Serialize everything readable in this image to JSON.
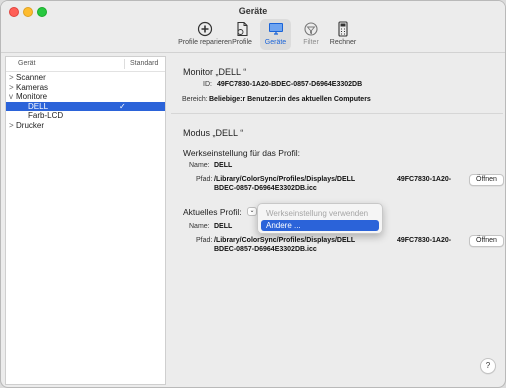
{
  "window": {
    "title": "Geräte"
  },
  "toolbar": {
    "items": [
      {
        "label": "Profile reparieren",
        "icon": "first-aid-icon"
      },
      {
        "label": "Profile",
        "icon": "profile-document-icon"
      },
      {
        "label": "Geräte",
        "icon": "display-icon",
        "active": true
      },
      {
        "label": "Filter",
        "icon": "filter-icon",
        "disabled": true
      },
      {
        "label": "Rechner",
        "icon": "calculator-icon"
      }
    ]
  },
  "sidebar": {
    "col_device": "Gerät",
    "col_standard": "Standard",
    "items": [
      {
        "label": "Scanner",
        "chevron": ">"
      },
      {
        "label": "Kameras",
        "chevron": ">"
      },
      {
        "label": "Monitore",
        "chevron": "v"
      },
      {
        "label": "DELL",
        "check": "✓"
      },
      {
        "label": "Farb-LCD"
      },
      {
        "label": "Drucker",
        "chevron": ">"
      }
    ]
  },
  "monitor": {
    "title": "Monitor „DELL          “",
    "id_label": "ID:",
    "id_value": "49FC7830-1A20-BDEC-0857-D6964E3302DB",
    "scope_label": "Bereich:",
    "scope_value": "Beliebige:r Benutzer:in des aktuellen Computers"
  },
  "mode": {
    "title": "Modus „DELL          “",
    "factory_heading": "Werkseinstellung für das Profil:",
    "name_label": "Name:",
    "name_value": "DELL",
    "path_label": "Pfad:",
    "path_line1": "/Library/ColorSync/Profiles/Displays/DELL",
    "path_line2": "BDEC-0857-D6964E3302DB.icc",
    "path_suffix": "49FC7830-1A20-",
    "open_button": "Öffnen",
    "current_label": "Aktuelles Profil:",
    "current_name_label": "Name:",
    "current_name_value": "DELL",
    "current_path_label": "Pfad:",
    "current_path_line1": "/Library/ColorSync/Profiles/Displays/DELL",
    "current_path_line2": "BDEC-0857-D6964E3302DB.icc",
    "current_path_suffix": "49FC7830-1A20-",
    "current_open_button": "Öffnen"
  },
  "popup_menu": {
    "items": [
      {
        "label": "Werkseinstellung verwenden",
        "disabled": true
      },
      {
        "label": "Andere ...",
        "highlighted": true
      }
    ]
  },
  "help": {
    "label": "?"
  },
  "colors": {
    "accent": "#2b63d9",
    "red": "#ff5f57",
    "yellow": "#febc2e",
    "green": "#28c840"
  }
}
